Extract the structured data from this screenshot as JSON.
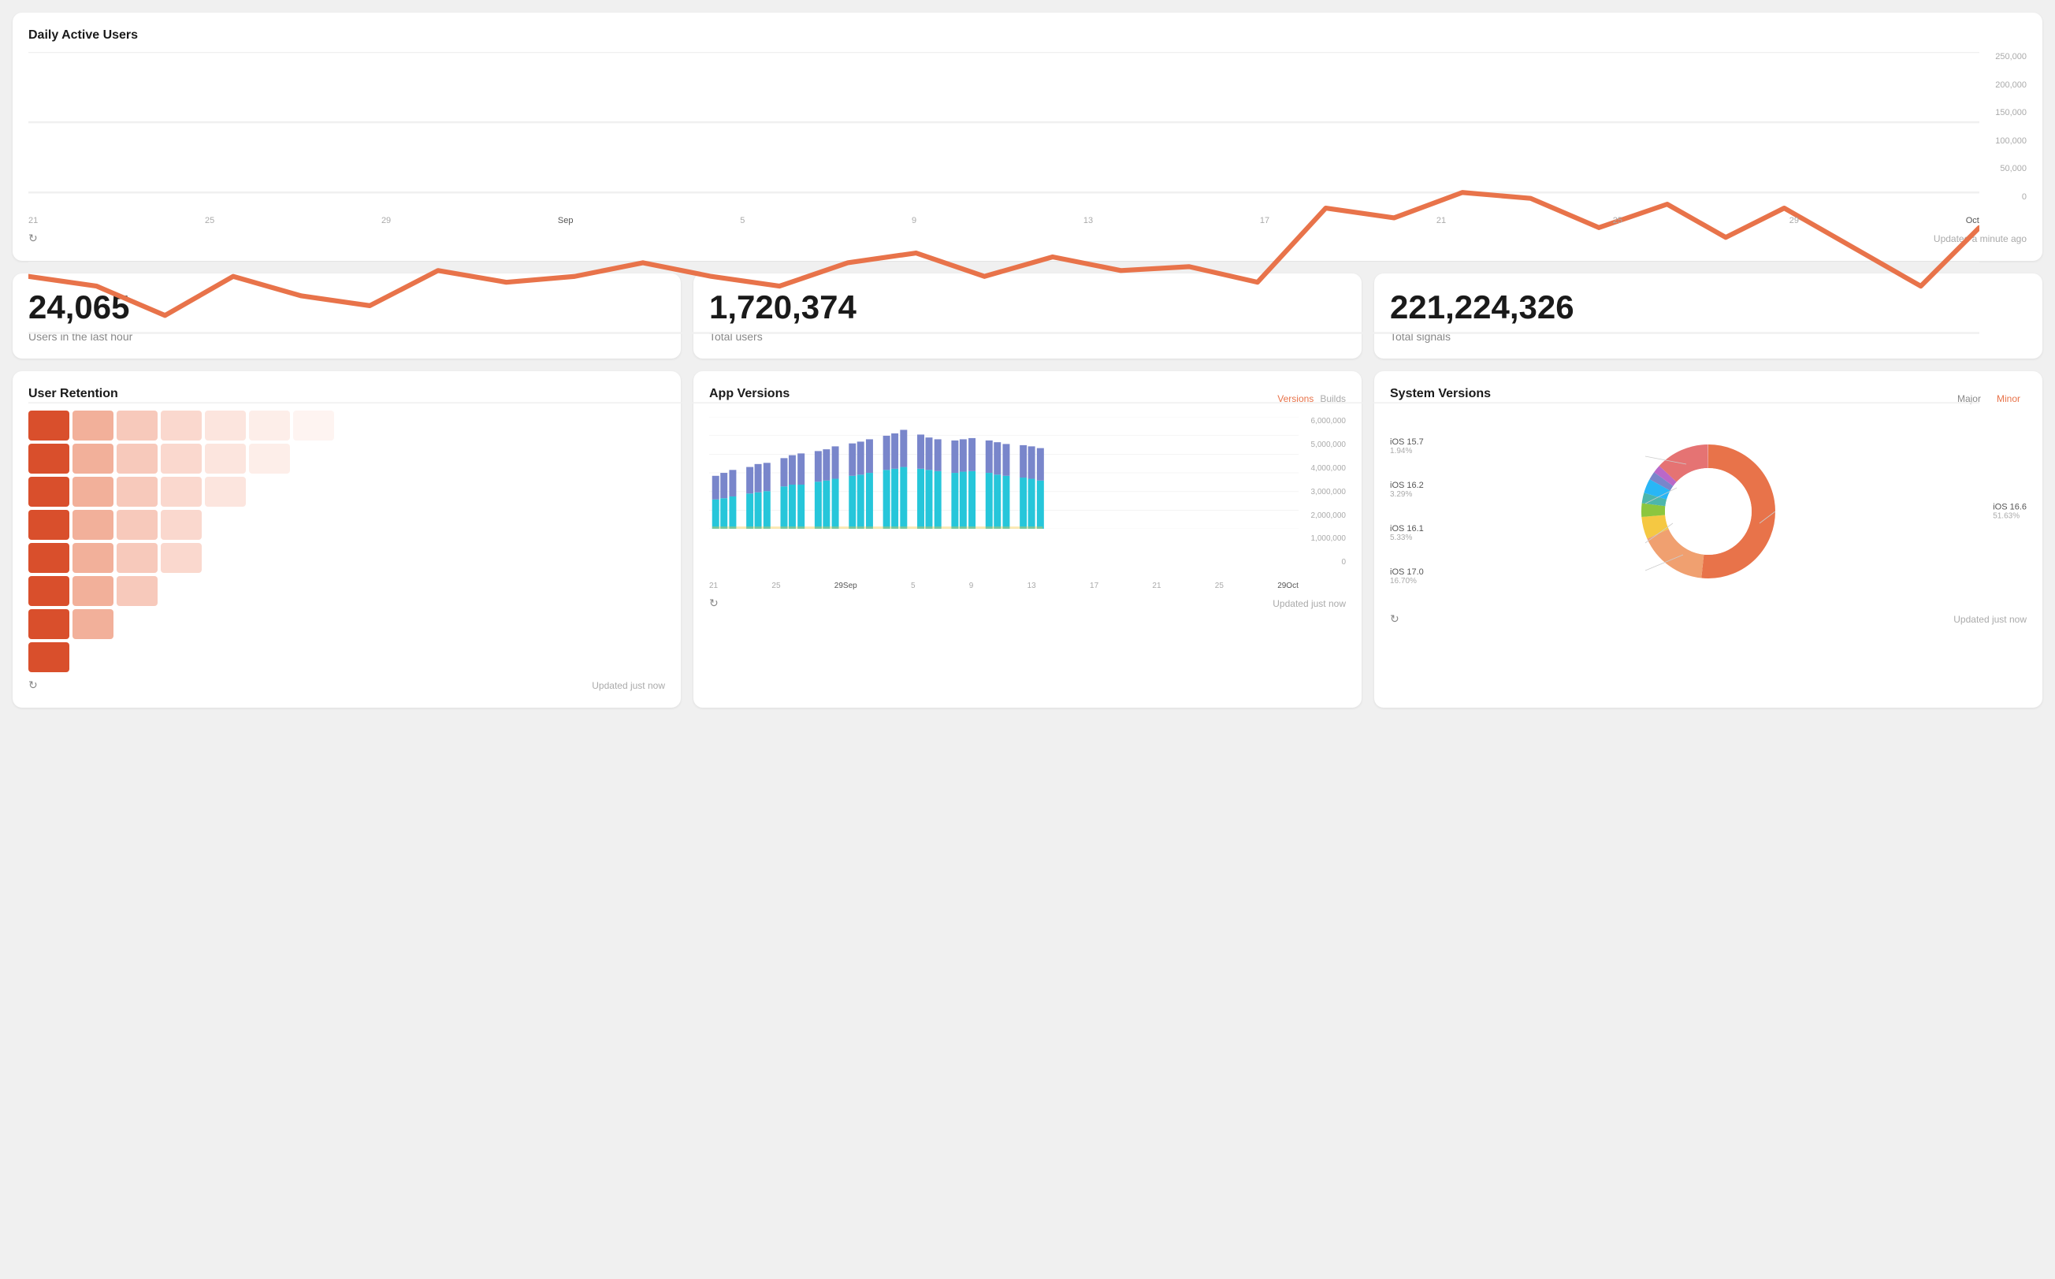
{
  "daily_chart": {
    "title": "Daily Active Users",
    "updated": "Updated a minute ago",
    "y_labels": [
      "250,000",
      "200,000",
      "150,000",
      "100,000",
      "50,000",
      "0"
    ],
    "x_labels": [
      {
        "label": "21",
        "sep": false
      },
      {
        "label": "25",
        "sep": false
      },
      {
        "label": "29",
        "sep": false
      },
      {
        "label": "Sep",
        "sep": true
      },
      {
        "label": "5",
        "sep": false
      },
      {
        "label": "9",
        "sep": false
      },
      {
        "label": "13",
        "sep": false
      },
      {
        "label": "17",
        "sep": false
      },
      {
        "label": "21",
        "sep": false
      },
      {
        "label": "25",
        "sep": false
      },
      {
        "label": "29",
        "sep": false
      },
      {
        "label": "Oct",
        "sep": true
      }
    ]
  },
  "stats": [
    {
      "value": "24,065",
      "label": "Users in the last hour"
    },
    {
      "value": "1,720,374",
      "label": "Total users"
    },
    {
      "value": "221,224,326",
      "label": "Total signals"
    }
  ],
  "user_retention": {
    "title": "User Retention",
    "updated": "Updated just now"
  },
  "app_versions": {
    "title": "App Versions",
    "updated": "Updated just now",
    "toggle_versions": "Versions",
    "toggle_builds": "Builds",
    "y_labels": [
      "6,000,000",
      "5,000,000",
      "4,000,000",
      "3,000,000",
      "2,000,000",
      "1,000,000",
      "0"
    ],
    "x_labels": [
      {
        "label": "21",
        "sep": false
      },
      {
        "label": "25",
        "sep": false
      },
      {
        "label": "29",
        "sep": false
      },
      {
        "label": "Sep",
        "sep": true
      },
      {
        "label": "5",
        "sep": false
      },
      {
        "label": "9",
        "sep": false
      },
      {
        "label": "13",
        "sep": false
      },
      {
        "label": "17",
        "sep": false
      },
      {
        "label": "21",
        "sep": false
      },
      {
        "label": "25",
        "sep": false
      },
      {
        "label": "29",
        "sep": false
      },
      {
        "label": "Oct",
        "sep": true
      }
    ]
  },
  "system_versions": {
    "title": "System Versions",
    "toggle_major": "Major",
    "toggle_minor": "Minor",
    "updated": "Updated just now",
    "labels": [
      {
        "name": "iOS 15.7",
        "pct": "1.94%"
      },
      {
        "name": "iOS 16.2",
        "pct": "3.29%"
      },
      {
        "name": "iOS 16.1",
        "pct": "5.33%"
      },
      {
        "name": "iOS 17.0",
        "pct": "16.70%"
      }
    ],
    "label_right": {
      "name": "iOS 16.6",
      "pct": "51.63%"
    },
    "segments": [
      {
        "color": "#e8734a",
        "pct": 51.63
      },
      {
        "color": "#f0a070",
        "pct": 16.7
      },
      {
        "color": "#f5c842",
        "pct": 5.33
      },
      {
        "color": "#8cc63f",
        "pct": 3.29
      },
      {
        "color": "#4db6ac",
        "pct": 2.5
      },
      {
        "color": "#29b6f6",
        "pct": 3.5
      },
      {
        "color": "#7986cb",
        "pct": 2.0
      },
      {
        "color": "#ba68c8",
        "pct": 1.94
      },
      {
        "color": "#e57373",
        "pct": 1.0
      },
      {
        "color": "#ff8a65",
        "pct": 2.11
      },
      {
        "color": "#a1887f",
        "pct": 10.0
      }
    ]
  }
}
